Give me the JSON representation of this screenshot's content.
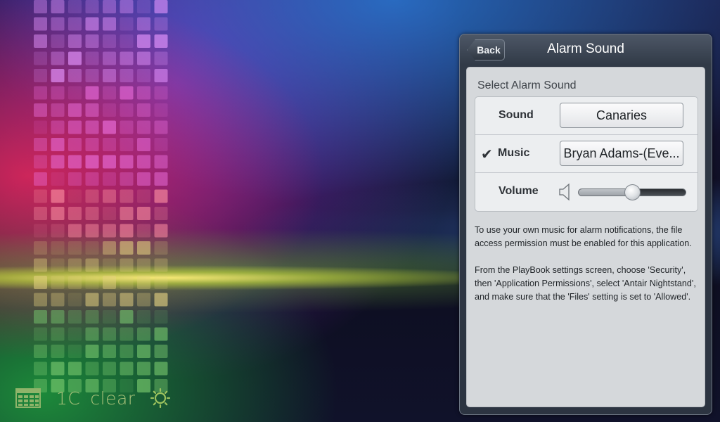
{
  "status_bar": {
    "calendar_icon": "calendar-icon",
    "temperature": "1C",
    "condition": "clear",
    "weather_icon": "sun-icon",
    "text_color": "#a9c27a"
  },
  "panel": {
    "back_label": "Back",
    "title": "Alarm Sound",
    "section_title": "Select Alarm Sound",
    "rows": {
      "sound": {
        "label": "Sound",
        "value": "Canaries",
        "checked": false
      },
      "music": {
        "label": "Music",
        "value": "Bryan Adams-(Eve...",
        "checked": true,
        "check_glyph": "✔"
      },
      "volume": {
        "label": "Volume",
        "level": 0.5,
        "icon": "speaker-icon"
      }
    },
    "help": {
      "paragraph1": "To use your own music for alarm notifications, the file access permission must be enabled for this application.",
      "paragraph2": "From the PlayBook settings screen, choose 'Security', then 'Application Permissions', select 'Antair Nightstand', and make sure that the 'Files' setting is set to 'Allowed'."
    }
  }
}
